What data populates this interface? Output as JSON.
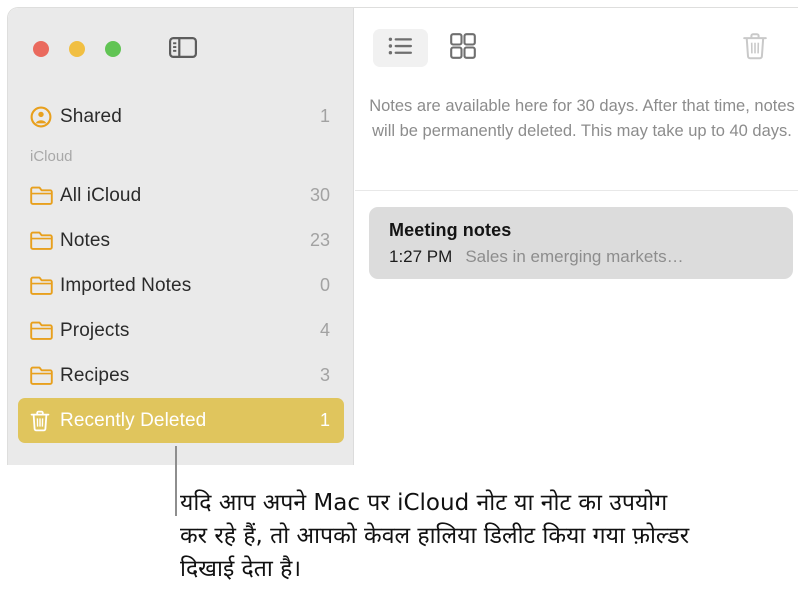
{
  "window": {
    "traffic_lights": [
      {
        "name": "close",
        "color": "#ea6a5e"
      },
      {
        "name": "minimize",
        "color": "#f1bf42"
      },
      {
        "name": "zoom",
        "color": "#61c454"
      }
    ],
    "sidebar_toggle_icon": "sidebar-toggle-icon"
  },
  "sidebar": {
    "shared": {
      "icon": "shared-person-icon",
      "label": "Shared",
      "count": "1"
    },
    "section_label": "iCloud",
    "folders": [
      {
        "icon": "folder-icon",
        "label": "All iCloud",
        "count": "30",
        "selected": false
      },
      {
        "icon": "folder-icon",
        "label": "Notes",
        "count": "23",
        "selected": false
      },
      {
        "icon": "folder-icon",
        "label": "Imported Notes",
        "count": "0",
        "selected": false
      },
      {
        "icon": "folder-icon",
        "label": "Projects",
        "count": "4",
        "selected": false
      },
      {
        "icon": "folder-icon",
        "label": "Recipes",
        "count": "3",
        "selected": false
      },
      {
        "icon": "trash-icon",
        "label": "Recently Deleted",
        "count": "1",
        "selected": true
      }
    ],
    "selection_color": "#e0c55d",
    "accent_color": "#e8a01d"
  },
  "toolbar": {
    "list_view_label": "list-view",
    "gallery_view_label": "gallery-view",
    "delete_label": "delete"
  },
  "content": {
    "info_text": "Notes are available here for 30 days. After that time, notes will be permanently deleted. This may take up to 40 days.",
    "notes": [
      {
        "title": "Meeting notes",
        "time": "1:27 PM",
        "snippet": "Sales in emerging markets…"
      }
    ]
  },
  "callout": {
    "text": "यदि आप अपने Mac पर iCloud नोट या नोट का उपयोग कर रहे हैं, तो आपको केवल हालिया डिलीट किया गया फ़ोल्डर दिखाई देता है।"
  }
}
